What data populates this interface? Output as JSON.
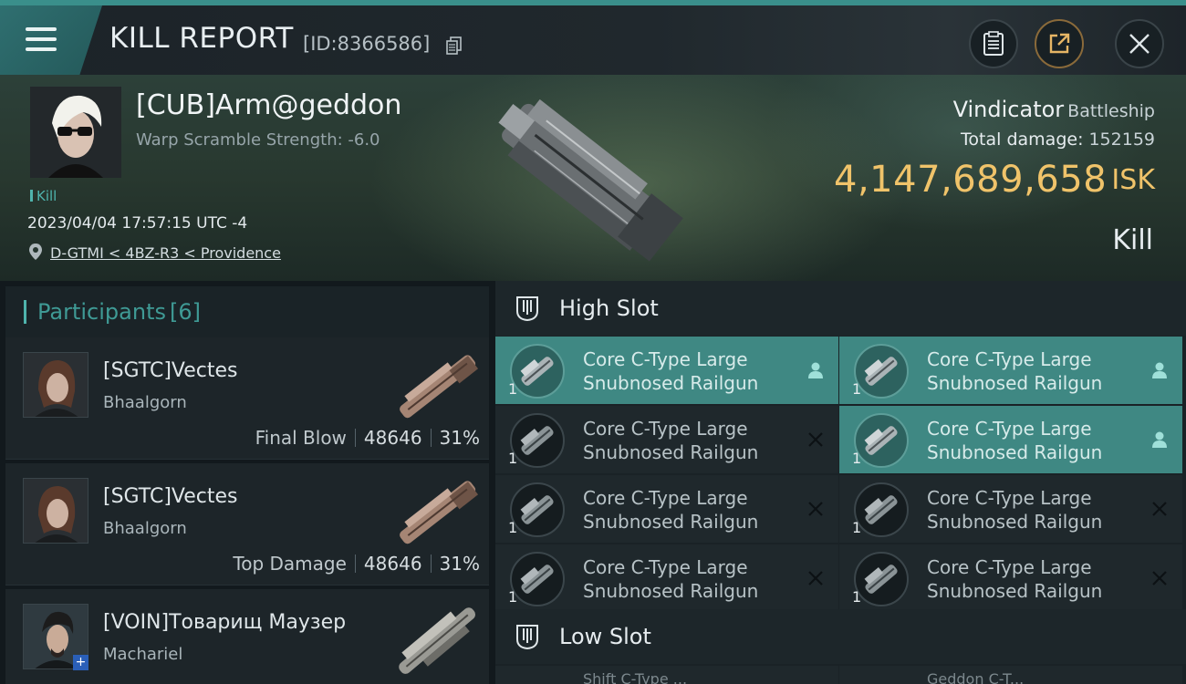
{
  "header": {
    "title": "KILL REPORT",
    "id_text": "[ID:8366586]",
    "icons": [
      "menu-icon",
      "copy-icon",
      "clipboard-icon",
      "share-icon",
      "close-icon"
    ]
  },
  "victim": {
    "name": "[CUB]Arm@geddon",
    "warp_scramble": "Warp Scramble Strength: -6.0",
    "kill_tag": "Kill",
    "datetime": "2023/04/04 17:57:15 UTC -4",
    "location": "D-GTMI < 4BZ-R3 < Providence",
    "ship_name": "Vindicator",
    "ship_class": "Battleship",
    "total_damage_label": "Total damage:",
    "total_damage": "152159",
    "isk_value": "4,147,689,658",
    "isk_unit": "ISK",
    "result": "Kill"
  },
  "participants": {
    "label": "Participants",
    "count": "[6]",
    "rows": [
      {
        "name": "[SGTC]Vectes",
        "ship": "Bhaalgorn",
        "role": "Final Blow",
        "damage": "48646",
        "percent": "31%"
      },
      {
        "name": "[SGTC]Vectes",
        "ship": "Bhaalgorn",
        "role": "Top Damage",
        "damage": "48646",
        "percent": "31%"
      },
      {
        "name": "[VOIN]Товарищ Маузер",
        "ship": "Machariel"
      }
    ]
  },
  "slots": {
    "high_label": "High Slot",
    "low_label": "Low Slot",
    "modules": [
      {
        "name_line1": "Core C-Type Large",
        "name_line2": "Snubnosed Railgun",
        "qty": "1",
        "status": "dropped"
      },
      {
        "name_line1": "Core C-Type Large",
        "name_line2": "Snubnosed Railgun",
        "qty": "1",
        "status": "dropped"
      },
      {
        "name_line1": "Core C-Type Large",
        "name_line2": "Snubnosed Railgun",
        "qty": "1",
        "status": "destroyed"
      },
      {
        "name_line1": "Core C-Type Large",
        "name_line2": "Snubnosed Railgun",
        "qty": "1",
        "status": "dropped"
      },
      {
        "name_line1": "Core C-Type Large",
        "name_line2": "Snubnosed Railgun",
        "qty": "1",
        "status": "destroyed"
      },
      {
        "name_line1": "Core C-Type Large",
        "name_line2": "Snubnosed Railgun",
        "qty": "1",
        "status": "destroyed"
      },
      {
        "name_line1": "Core C-Type Large",
        "name_line2": "Snubnosed Railgun",
        "qty": "1",
        "status": "destroyed"
      },
      {
        "name_line1": "Core C-Type Large",
        "name_line2": "Snubnosed Railgun",
        "qty": "1",
        "status": "destroyed"
      }
    ],
    "low_peek": [
      "Shift C-Type ...",
      "Geddon C-T..."
    ]
  },
  "colors": {
    "accent_teal": "#3f8883",
    "isk_gold": "#f0c36a",
    "participants_teal": "#3f9a95"
  }
}
